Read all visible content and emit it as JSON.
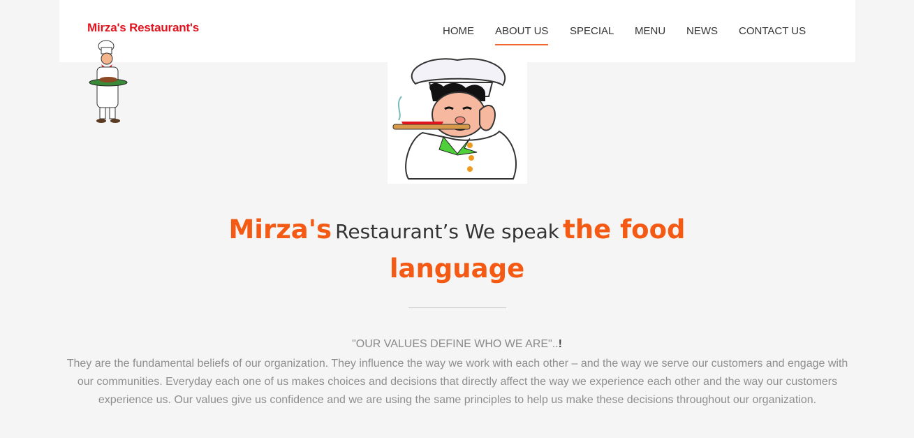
{
  "header": {
    "logo_text": "Mirza's Restaurant's"
  },
  "nav": {
    "items": [
      {
        "label": "HOME",
        "active": false
      },
      {
        "label": "ABOUT US",
        "active": true
      },
      {
        "label": "SPECIAL",
        "active": false
      },
      {
        "label": "MENU",
        "active": false
      },
      {
        "label": "NEWS",
        "active": false
      },
      {
        "label": "CONTACT US",
        "active": false
      }
    ]
  },
  "headline": {
    "part1": "Mirza's",
    "part2": "Restaurant’s We speak",
    "part3": "the food language"
  },
  "values": {
    "title": "\"OUR VALUES DEFINE WHO WE ARE\"..",
    "title_mark": "!",
    "body": "They are the fundamental beliefs of our organization. They influence the way we work with each other – and the way we serve our customers and engage with our communities. Everyday each one of us makes choices and decisions that directly affect the way we experience each other and the way our customers experience us. Our values give us confidence and we are using the same principles to help us make these decisions throughout our organization."
  },
  "colors": {
    "accent": "#f45a14",
    "logo": "#e0141e",
    "page_background": "#f5f5f5"
  }
}
